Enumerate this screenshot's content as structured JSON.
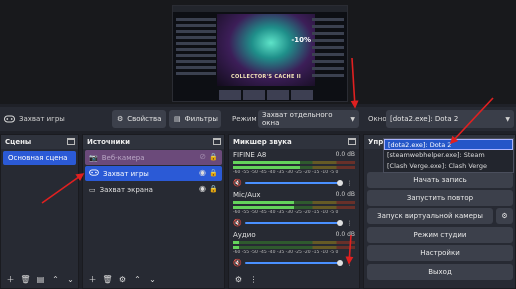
{
  "preview": {
    "game_banner": "COLLECTOR'S CACHE II",
    "game_sale": "-10%"
  },
  "toolbar": {
    "source_name": "Захват игры",
    "properties_label": "Свойства",
    "filters_label": "Фильтры",
    "mode_label": "Режим",
    "mode_value": "Захват отдельного окна",
    "window_label": "Окно",
    "window_value": "[dota2.exe]: Dota 2"
  },
  "scenes": {
    "title": "Сцены",
    "items": [
      "Основная сцена"
    ]
  },
  "sources": {
    "title": "Источники",
    "items": [
      {
        "label": "Веб-камера",
        "icon": "camera-icon",
        "state": "disabled"
      },
      {
        "label": "Захват игры",
        "icon": "gamepad-icon",
        "state": "selected"
      },
      {
        "label": "Захват экрана",
        "icon": "monitor-icon",
        "state": "normal"
      }
    ]
  },
  "mixer": {
    "title": "Микшер звука",
    "ticks": "-60 -55 -50 -45 -40 -35 -30 -25 -20 -15 -10 -5 0",
    "channels": [
      {
        "name": "FIFINE A8",
        "db": "0.0 dB",
        "level": 0.55,
        "muted": true
      },
      {
        "name": "Mic/Aux",
        "db": "0.0 dB",
        "level": 0.5,
        "muted": true
      },
      {
        "name": "Аудио",
        "db": "0.0 dB",
        "level": 0.05,
        "muted": true
      }
    ]
  },
  "controls": {
    "title": "Упра",
    "buttons": [
      "Начать запись",
      "Запустить повтор",
      "Запуск виртуальной камеры",
      "Режим студии",
      "Настройки",
      "Выход"
    ]
  },
  "window_dropdown": {
    "options": [
      "[dota2.exe]: Dota 2",
      "[steamwebhelper.exe]: Steam",
      "[Clash Verge.exe]: Clash Verge"
    ],
    "selected_index": 0
  },
  "colors": {
    "accent": "#2b5ad6",
    "annotation": "#e02020",
    "disabled_row": "#6b4a7a"
  }
}
